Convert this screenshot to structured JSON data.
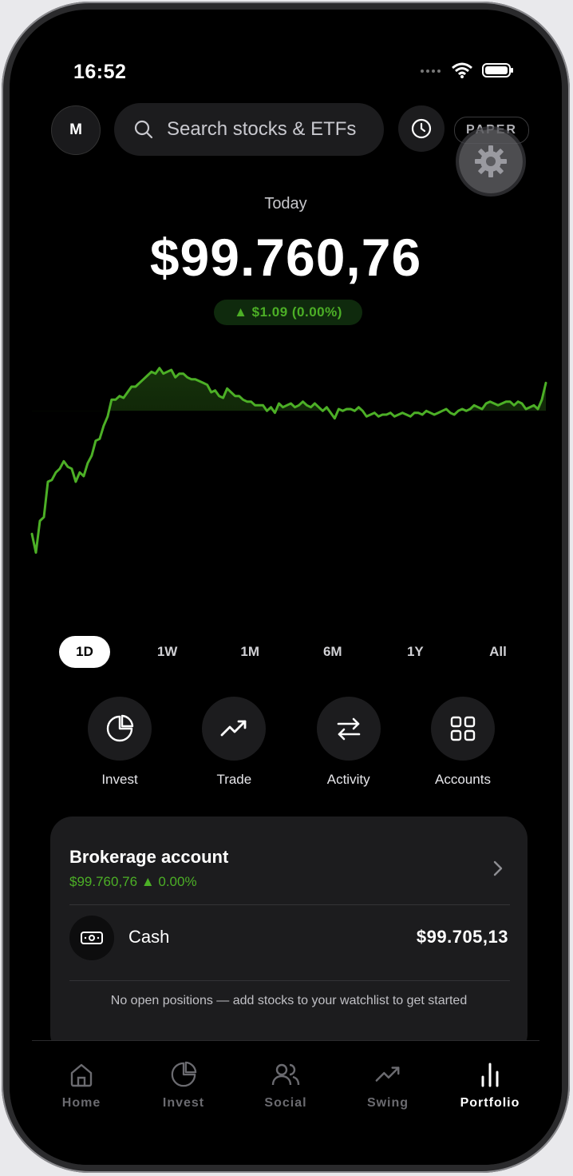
{
  "status_bar": {
    "time": "16:52"
  },
  "header": {
    "avatar_initial": "M",
    "search_placeholder": "Search stocks & ETFs",
    "mode_badge": "PAPER"
  },
  "portfolio": {
    "period_label": "Today",
    "balance": "$99.760,76",
    "change": "▲ $1.09 (0.00%)",
    "accent_color": "#4caf26"
  },
  "chart_data": {
    "type": "area",
    "title": "",
    "xlabel": "",
    "ylabel": "",
    "y": [
      0.27,
      0.17,
      0.34,
      0.36,
      0.55,
      0.56,
      0.6,
      0.62,
      0.66,
      0.63,
      0.62,
      0.55,
      0.6,
      0.58,
      0.65,
      0.69,
      0.77,
      0.78,
      0.85,
      0.9,
      0.99,
      0.99,
      1.01,
      1.0,
      1.03,
      1.06,
      1.06,
      1.08,
      1.1,
      1.12,
      1.14,
      1.13,
      1.16,
      1.13,
      1.14,
      1.15,
      1.11,
      1.13,
      1.13,
      1.11,
      1.1,
      1.1,
      1.09,
      1.08,
      1.07,
      1.03,
      1.04,
      1.01,
      1.0,
      1.05,
      1.03,
      1.01,
      1.01,
      0.99,
      0.98,
      0.98,
      0.96,
      0.96,
      0.96,
      0.93,
      0.95,
      0.92,
      0.97,
      0.95,
      0.96,
      0.97,
      0.95,
      0.96,
      0.98,
      0.96,
      0.95,
      0.97,
      0.95,
      0.93,
      0.95,
      0.92,
      0.89,
      0.94,
      0.93,
      0.94,
      0.94,
      0.93,
      0.95,
      0.93,
      0.9,
      0.91,
      0.92,
      0.9,
      0.91,
      0.91,
      0.92,
      0.9,
      0.91,
      0.92,
      0.91,
      0.9,
      0.92,
      0.92,
      0.91,
      0.93,
      0.92,
      0.91,
      0.92,
      0.93,
      0.94,
      0.92,
      0.91,
      0.93,
      0.94,
      0.93,
      0.94,
      0.96,
      0.95,
      0.94,
      0.97,
      0.98,
      0.97,
      0.96,
      0.97,
      0.98,
      0.98,
      0.96,
      0.98,
      0.97,
      0.94,
      0.95,
      0.96,
      0.94,
      0.99,
      1.08
    ],
    "baseline": 0.93,
    "ylim": [
      0.1,
      1.18
    ],
    "grid": false,
    "legend": "none"
  },
  "ranges": [
    "1D",
    "1W",
    "1M",
    "6M",
    "1Y",
    "All"
  ],
  "actions": [
    {
      "label": "Invest",
      "icon": "pie-chart-icon"
    },
    {
      "label": "Trade",
      "icon": "trending-up-icon"
    },
    {
      "label": "Activity",
      "icon": "swap-arrows-icon"
    },
    {
      "label": "Accounts",
      "icon": "grid-icon"
    }
  ],
  "brokerage": {
    "title": "Brokerage account",
    "value": "$99.760,76",
    "change": "▲ 0.00%",
    "cash_label": "Cash",
    "cash_value": "$99.705,13",
    "empty_note": "No open positions — add stocks to your watchlist to get started"
  },
  "tabs": [
    {
      "label": "Home",
      "icon": "home-icon",
      "active": false
    },
    {
      "label": "Invest",
      "icon": "pie-chart-icon",
      "active": false
    },
    {
      "label": "Social",
      "icon": "users-icon",
      "active": false
    },
    {
      "label": "Swing",
      "icon": "trending-up-icon",
      "active": false
    },
    {
      "label": "Portfolio",
      "icon": "bar-chart-icon",
      "active": true
    }
  ]
}
